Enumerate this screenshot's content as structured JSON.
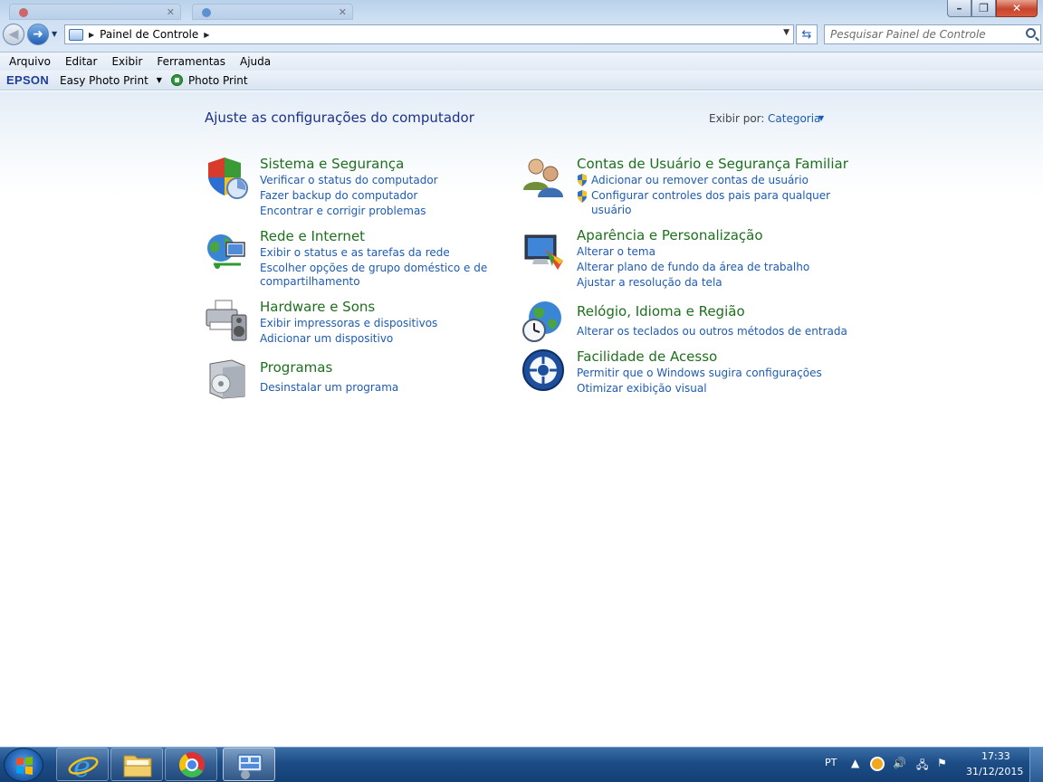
{
  "window": {
    "min_label": "–",
    "max_label": "❐",
    "close_label": "✕"
  },
  "address": {
    "path": "Painel de Controle"
  },
  "search": {
    "placeholder": "Pesquisar Painel de Controle"
  },
  "menu": [
    "Arquivo",
    "Editar",
    "Exibir",
    "Ferramentas",
    "Ajuda"
  ],
  "toolbar": {
    "brand": "EPSON",
    "easy_photo_print": "Easy Photo Print",
    "photo_print": "Photo Print"
  },
  "main": {
    "title": "Ajuste as configurações do computador",
    "view_by_label": "Exibir por:",
    "view_by_value": "Categoria"
  },
  "categories": {
    "system": {
      "title": "Sistema e Segurança",
      "links": [
        "Verificar o status do computador",
        "Fazer backup do computador",
        "Encontrar e corrigir problemas"
      ]
    },
    "network": {
      "title": "Rede e Internet",
      "links": [
        "Exibir o status e as tarefas da rede",
        "Escolher opções de grupo doméstico e de",
        "compartilhamento"
      ]
    },
    "hardware": {
      "title": "Hardware e Sons",
      "links": [
        "Exibir impressoras e dispositivos",
        "Adicionar um dispositivo"
      ]
    },
    "programs": {
      "title": "Programas",
      "links": [
        "Desinstalar um programa"
      ]
    },
    "users": {
      "title": "Contas de Usuário e Segurança Familiar",
      "links": [
        "Adicionar ou remover contas de usuário",
        "Configurar controles dos pais para qualquer",
        "usuário"
      ]
    },
    "appearance": {
      "title": "Aparência e Personalização",
      "links": [
        "Alterar o tema",
        "Alterar plano de fundo da área de trabalho",
        "Ajustar a resolução da tela"
      ]
    },
    "clock": {
      "title": "Relógio, Idioma e Região",
      "links": [
        "Alterar os teclados ou outros métodos de entrada"
      ]
    },
    "access": {
      "title": "Facilidade de Acesso",
      "links": [
        "Permitir que o Windows sugira configurações",
        "Otimizar exibição visual"
      ]
    }
  },
  "taskbar": {
    "language": "PT",
    "time": "17:33",
    "date": "31/12/2015"
  },
  "colors": {
    "link": "#1e5bb0",
    "category_title": "#1e6f1e",
    "taskbar": "#1c4c86"
  }
}
